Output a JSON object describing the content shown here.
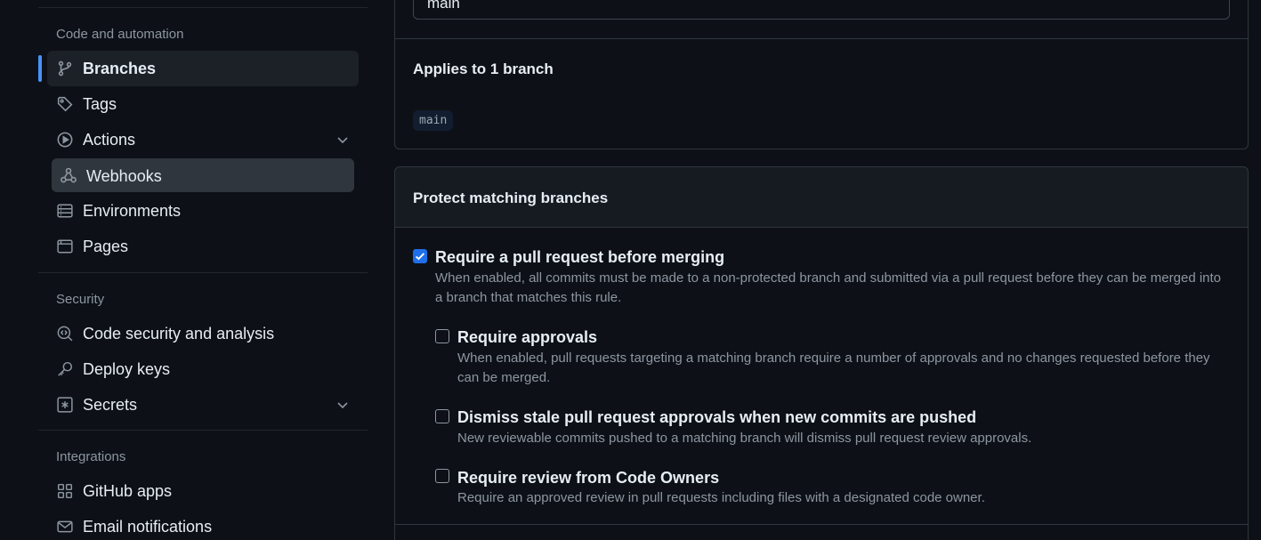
{
  "sidebar": {
    "code_automation": {
      "heading": "Code and automation",
      "items": [
        {
          "label": "Branches",
          "icon": "git-branch-icon"
        },
        {
          "label": "Tags",
          "icon": "tag-icon"
        },
        {
          "label": "Actions",
          "icon": "play-icon",
          "expandable": true
        },
        {
          "label": "Webhooks",
          "icon": "webhook-icon"
        },
        {
          "label": "Environments",
          "icon": "server-icon"
        },
        {
          "label": "Pages",
          "icon": "browser-icon"
        }
      ]
    },
    "security": {
      "heading": "Security",
      "items": [
        {
          "label": "Code security and analysis",
          "icon": "codescan-icon"
        },
        {
          "label": "Deploy keys",
          "icon": "key-icon"
        },
        {
          "label": "Secrets",
          "icon": "asterisk-icon",
          "expandable": true
        }
      ]
    },
    "integrations": {
      "heading": "Integrations",
      "items": [
        {
          "label": "GitHub apps",
          "icon": "apps-icon"
        },
        {
          "label": "Email notifications",
          "icon": "mail-icon"
        }
      ]
    }
  },
  "main": {
    "pattern_input": {
      "value": "main"
    },
    "applies": {
      "title": "Applies to 1 branch",
      "branches": [
        "main"
      ]
    },
    "protect": {
      "title": "Protect matching branches",
      "options": [
        {
          "title": "Require a pull request before merging",
          "desc_line1": "When enabled, all commits must be made to a non-protected branch and submitted via a pull request before they can be merged into",
          "desc_line2": "a branch that matches this rule.",
          "checked": true
        },
        {
          "title": "Require approvals",
          "desc_line1": "When enabled, pull requests targeting a matching branch require a number of approvals and no changes requested before they",
          "desc_line2": "can be merged.",
          "checked": false
        },
        {
          "title": "Dismiss stale pull request approvals when new commits are pushed",
          "desc_line1": "New reviewable commits pushed to a matching branch will dismiss pull request review approvals.",
          "checked": false
        },
        {
          "title": "Require review from Code Owners",
          "desc_line1": "Require an approved review in pull requests including files with a designated code owner.",
          "checked": false
        }
      ]
    }
  },
  "colors": {
    "background": "#0d1117",
    "accent": "#1f6feb",
    "active_indicator": "#4493f8",
    "muted_text": "#8d96a0",
    "border": "#30363d"
  }
}
